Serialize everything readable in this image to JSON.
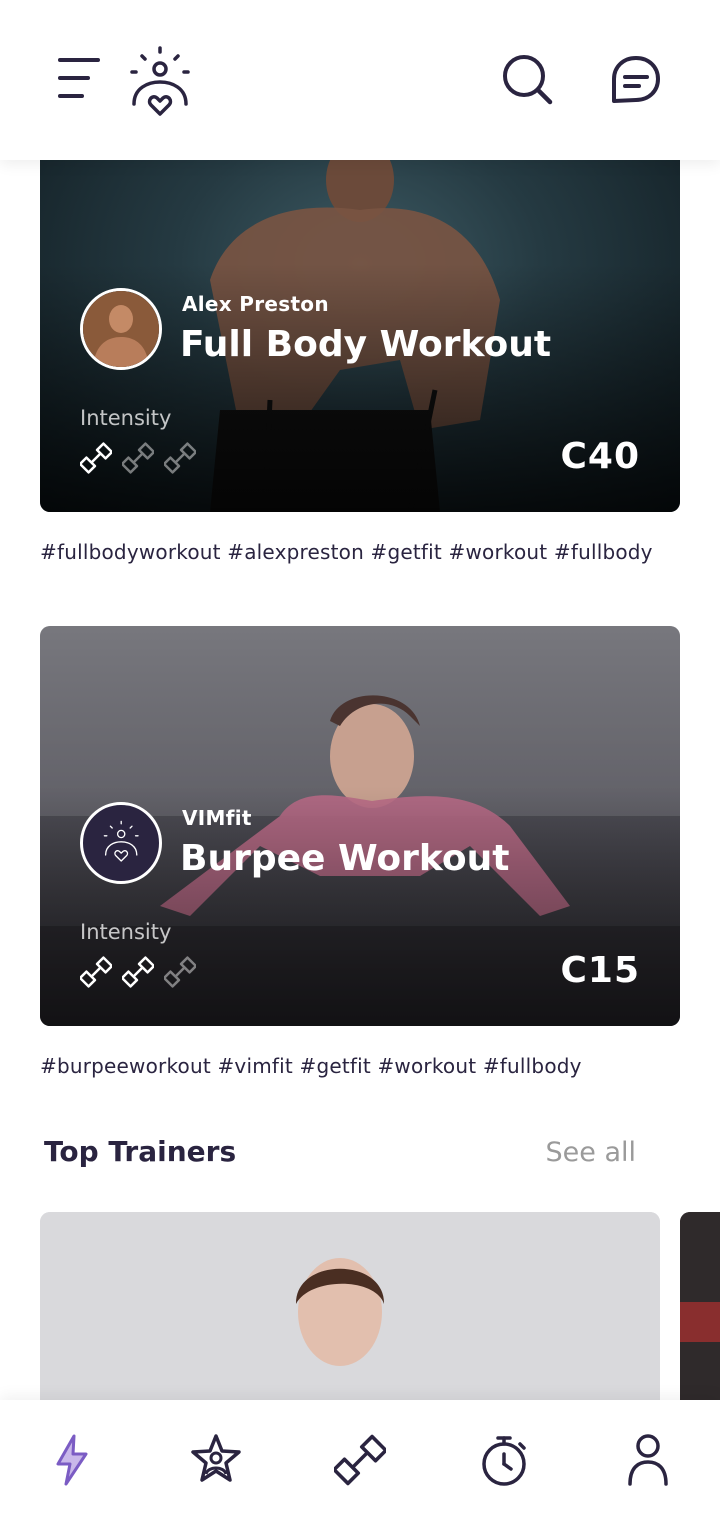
{
  "header": {
    "menu_icon": "hamburger-menu-icon",
    "logo_icon": "meditation-heart-logo",
    "search_icon": "search-icon",
    "chat_icon": "chat-bubble-icon"
  },
  "workouts": [
    {
      "trainer": "Alex Preston",
      "title": "Full Body Workout",
      "intensity_label": "Intensity",
      "intensity_level": 1,
      "intensity_max": 3,
      "price": "C40",
      "tags": "#fullbodyworkout #alexpreston #getfit #workout #fullbody"
    },
    {
      "trainer": "VIMfit",
      "title": "Burpee Workout",
      "intensity_label": "Intensity",
      "intensity_level": 2,
      "intensity_max": 3,
      "price": "C15",
      "tags": "#burpeeworkout #vimfit #getfit #workout #fullbody"
    }
  ],
  "top_trainers": {
    "title": "Top Trainers",
    "see_all": "See all"
  },
  "tabbar": {
    "items": [
      "lightning-icon",
      "star-person-icon",
      "dumbbell-icon",
      "stopwatch-icon",
      "profile-icon"
    ],
    "active": 0,
    "accent": "#7b5cc4"
  },
  "colors": {
    "primary": "#2a2440",
    "muted": "#9a9a9a"
  }
}
